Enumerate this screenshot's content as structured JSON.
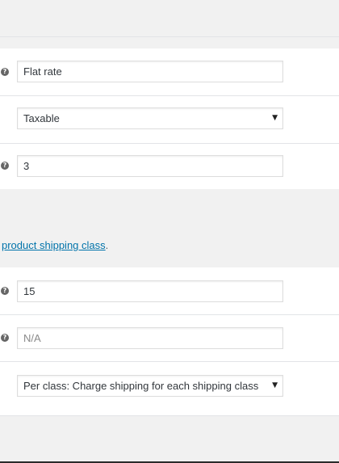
{
  "rows": {
    "method_title": {
      "value": "Flat rate"
    },
    "tax_status": {
      "selected": "Taxable"
    },
    "cost": {
      "value": "3"
    },
    "class_cost": {
      "value": "15"
    },
    "no_class_cost": {
      "value": "",
      "placeholder": "N/A"
    },
    "calculation_type": {
      "selected": "Per class: Charge shipping for each shipping class"
    }
  },
  "shipping_classes": {
    "description_link": "product shipping class",
    "description_suffix": "."
  },
  "icons": {
    "help": "help-tip-icon",
    "dropdown": "dropdown-arrow-icon"
  },
  "colors": {
    "link": "#0073aa",
    "help_icon": "#666666",
    "band_gray": "#f1f1f1"
  }
}
